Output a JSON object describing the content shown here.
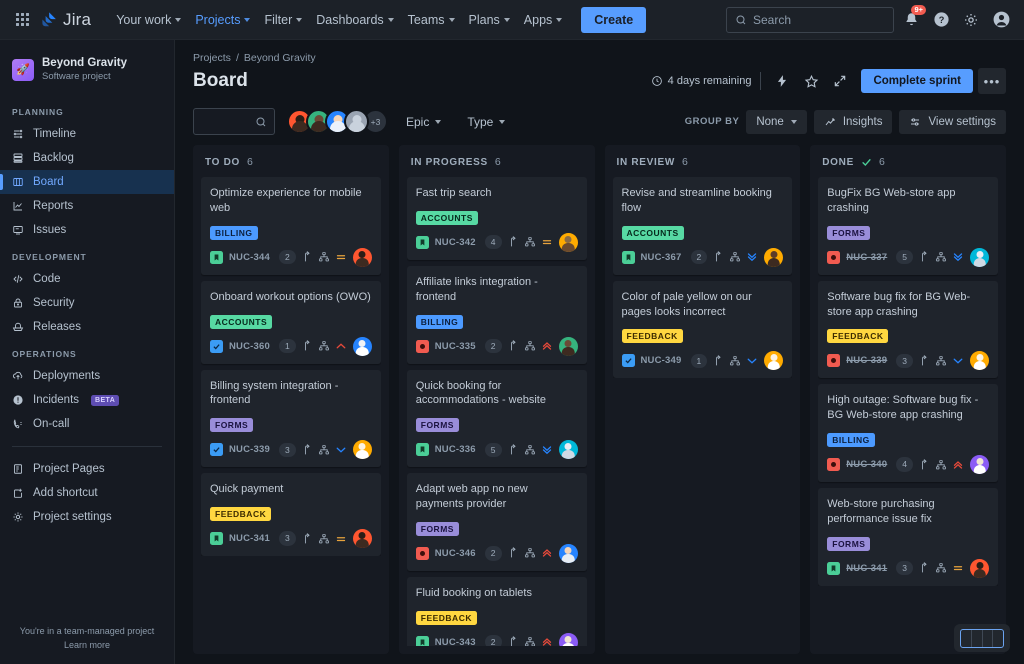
{
  "topnav": {
    "apps_label": "app-switcher",
    "brand": "Jira",
    "links": [
      {
        "label": "Your work",
        "caret": true,
        "active": false
      },
      {
        "label": "Projects",
        "caret": true,
        "active": true
      },
      {
        "label": "Filter",
        "caret": true,
        "active": false
      },
      {
        "label": "Dashboards",
        "caret": true,
        "active": false
      },
      {
        "label": "Teams",
        "caret": true,
        "active": false
      },
      {
        "label": "Plans",
        "caret": true,
        "active": false
      },
      {
        "label": "Apps",
        "caret": true,
        "active": false
      }
    ],
    "create_label": "Create",
    "search_placeholder": "Search",
    "notification_badge": "9+"
  },
  "sidebar": {
    "project_name": "Beyond Gravity",
    "project_type": "Software project",
    "sections": [
      {
        "title": "PLANNING",
        "items": [
          {
            "label": "Timeline",
            "icon": "timeline-icon",
            "selected": false
          },
          {
            "label": "Backlog",
            "icon": "backlog-icon",
            "selected": false
          },
          {
            "label": "Board",
            "icon": "board-icon",
            "selected": true
          },
          {
            "label": "Reports",
            "icon": "reports-icon",
            "selected": false
          },
          {
            "label": "Issues",
            "icon": "issues-icon",
            "selected": false
          }
        ]
      },
      {
        "title": "DEVELOPMENT",
        "items": [
          {
            "label": "Code",
            "icon": "code-icon",
            "selected": false
          },
          {
            "label": "Security",
            "icon": "lock-icon",
            "selected": false
          },
          {
            "label": "Releases",
            "icon": "releases-icon",
            "selected": false
          }
        ]
      },
      {
        "title": "OPERATIONS",
        "items": [
          {
            "label": "Deployments",
            "icon": "deployments-icon",
            "selected": false
          },
          {
            "label": "Incidents",
            "icon": "incidents-icon",
            "selected": false,
            "tag": "BETA"
          },
          {
            "label": "On-call",
            "icon": "oncall-icon",
            "selected": false
          }
        ]
      }
    ],
    "extra_items": [
      {
        "label": "Project Pages",
        "icon": "pages-icon"
      },
      {
        "label": "Add shortcut",
        "icon": "add-shortcut-icon"
      },
      {
        "label": "Project settings",
        "icon": "gear-icon"
      }
    ],
    "footer_line1": "You're in a team-managed project",
    "footer_line2": "Learn more"
  },
  "header": {
    "breadcrumb_projects": "Projects",
    "breadcrumb_sep": "/",
    "breadcrumb_project": "Beyond Gravity",
    "title": "Board",
    "days_remaining": "4 days remaining",
    "complete_sprint_label": "Complete sprint",
    "more_label": "•••"
  },
  "filterbar": {
    "search_placeholder": "",
    "avatars": [
      {
        "name": "avatar-1",
        "ring": "#ff5630",
        "head": "#3d2a20",
        "body": "#4a3328"
      },
      {
        "name": "avatar-2",
        "ring": "#36b37e",
        "head": "#6b4a36",
        "body": "#3d2a20"
      },
      {
        "name": "avatar-3",
        "ring": "#2684ff",
        "head": "#f5d5b8",
        "body": "#cfe3ff"
      },
      {
        "name": "avatar-4",
        "ring": "#9aa4b2",
        "head": "#c3ccd7",
        "body": "#c3ccd7"
      }
    ],
    "avatar_overflow": "+3",
    "epic_label": "Epic",
    "type_label": "Type",
    "group_by_label": "GROUP BY",
    "group_by_value": "None",
    "insights_label": "Insights",
    "view_settings_label": "View settings"
  },
  "columns": [
    {
      "name": "TO DO",
      "count": "6",
      "done": false,
      "cards": [
        {
          "title": "Optimize experience for mobile web",
          "epic": "BILLING",
          "epic_bg": "#4c9aff",
          "epic_fg": "#0c1f3d",
          "type": "story",
          "key": "NUC-344",
          "key_done": false,
          "pill": "2",
          "priority": "medium",
          "avatar": {
            "ring": "#ff5630",
            "head": "#2b1d16",
            "body": "#3d2a20"
          }
        },
        {
          "title": "Onboard workout options (OWO)",
          "epic": "ACCOUNTS",
          "epic_bg": "#57d9a3",
          "epic_fg": "#06291c",
          "type": "task",
          "key": "NUC-360",
          "key_done": false,
          "pill": "1",
          "priority": "high",
          "avatar": {
            "ring": "#2684ff",
            "head": "#f0f2f5",
            "body": "#ffffff"
          }
        },
        {
          "title": "Billing system integration - frontend",
          "epic": "FORMS",
          "epic_bg": "#998dd9",
          "epic_fg": "#1b1340",
          "type": "task",
          "key": "NUC-339",
          "key_done": false,
          "pill": "3",
          "priority": "low",
          "avatar": {
            "ring": "#ffab00",
            "head": "#fbf3e4",
            "body": "#ffffff"
          }
        },
        {
          "title": "Quick payment",
          "epic": "FEEDBACK",
          "epic_bg": "#ffd740",
          "epic_fg": "#3d2c00",
          "type": "story",
          "key": "NUC-341",
          "key_done": false,
          "pill": "3",
          "priority": "medium",
          "avatar": {
            "ring": "#ff5630",
            "head": "#2b1d16",
            "body": "#3d2a20"
          }
        }
      ]
    },
    {
      "name": "IN PROGRESS",
      "count": "6",
      "done": false,
      "cards": [
        {
          "title": "Fast trip search",
          "epic": "ACCOUNTS",
          "epic_bg": "#57d9a3",
          "epic_fg": "#06291c",
          "type": "story",
          "key": "NUC-342",
          "key_done": false,
          "pill": "4",
          "priority": "medium",
          "avatar": {
            "ring": "#ffab00",
            "head": "#8a6b45",
            "body": "#6b4a2e"
          }
        },
        {
          "title": "Affiliate links integration - frontend",
          "epic": "BILLING",
          "epic_bg": "#4c9aff",
          "epic_fg": "#0c1f3d",
          "type": "bug",
          "key": "NUC-335",
          "key_done": false,
          "pill": "2",
          "priority": "highest",
          "avatar": {
            "ring": "#36b37e",
            "head": "#6b4a36",
            "body": "#3d2a20"
          }
        },
        {
          "title": "Quick booking for accommodations - website",
          "epic": "FORMS",
          "epic_bg": "#998dd9",
          "epic_fg": "#1b1340",
          "type": "story",
          "key": "NUC-336",
          "key_done": false,
          "pill": "5",
          "priority": "lowest",
          "avatar": {
            "ring": "#00b8d9",
            "head": "#e8eef5",
            "body": "#cfd9e4"
          }
        },
        {
          "title": "Adapt web app no new payments provider",
          "epic": "FORMS",
          "epic_bg": "#998dd9",
          "epic_fg": "#1b1340",
          "type": "bug",
          "key": "NUC-346",
          "key_done": false,
          "pill": "2",
          "priority": "highest",
          "avatar": {
            "ring": "#2684ff",
            "head": "#f5d5b8",
            "body": "#e8eef5"
          }
        },
        {
          "title": "Fluid booking on tablets",
          "epic": "FEEDBACK",
          "epic_bg": "#ffd740",
          "epic_fg": "#3d2c00",
          "type": "story",
          "key": "NUC-343",
          "key_done": false,
          "pill": "2",
          "priority": "highest",
          "avatar": {
            "ring": "#8b5cf6",
            "head": "#f0e6d2",
            "body": "#ffffff"
          }
        }
      ]
    },
    {
      "name": "IN REVIEW",
      "count": "6",
      "done": false,
      "cards": [
        {
          "title": "Revise and streamline booking flow",
          "epic": "ACCOUNTS",
          "epic_bg": "#57d9a3",
          "epic_fg": "#06291c",
          "type": "story",
          "key": "NUC-367",
          "key_done": false,
          "pill": "2",
          "priority": "lowest",
          "avatar": {
            "ring": "#ffab00",
            "head": "#5c3c28",
            "body": "#3d2a20"
          }
        },
        {
          "title": "Color of pale yellow on our pages looks incorrect",
          "epic": "FEEDBACK",
          "epic_bg": "#ffd740",
          "epic_fg": "#3d2c00",
          "type": "task",
          "key": "NUC-349",
          "key_done": false,
          "pill": "1",
          "priority": "low",
          "avatar": {
            "ring": "#ffab00",
            "head": "#fbf3e4",
            "body": "#ffffff"
          }
        }
      ]
    },
    {
      "name": "DONE",
      "count": "6",
      "done": true,
      "cards": [
        {
          "title": "BugFix BG Web-store app crashing",
          "epic": "FORMS",
          "epic_bg": "#998dd9",
          "epic_fg": "#1b1340",
          "type": "bug",
          "key": "NUC-337",
          "key_done": true,
          "pill": "5",
          "priority": "lowest",
          "avatar": {
            "ring": "#00b8d9",
            "head": "#e8eef5",
            "body": "#cfd9e4"
          }
        },
        {
          "title": "Software bug fix for BG Web-store app crashing",
          "epic": "FEEDBACK",
          "epic_bg": "#ffd740",
          "epic_fg": "#3d2c00",
          "type": "bug",
          "key": "NUC-339",
          "key_done": true,
          "pill": "3",
          "priority": "low",
          "avatar": {
            "ring": "#ffab00",
            "head": "#fbf3e4",
            "body": "#ffffff"
          }
        },
        {
          "title": "High outage: Software bug fix - BG Web-store app crashing",
          "epic": "BILLING",
          "epic_bg": "#4c9aff",
          "epic_fg": "#0c1f3d",
          "type": "bug",
          "key": "NUC-340",
          "key_done": true,
          "pill": "4",
          "priority": "highest",
          "avatar": {
            "ring": "#8b5cf6",
            "head": "#f0e6d2",
            "body": "#ffffff"
          }
        },
        {
          "title": "Web-store purchasing performance issue fix",
          "epic": "FORMS",
          "epic_bg": "#998dd9",
          "epic_fg": "#1b1340",
          "type": "story",
          "key": "NUC-341",
          "key_done": true,
          "pill": "3",
          "priority": "medium",
          "avatar": {
            "ring": "#ff5630",
            "head": "#2b1d16",
            "body": "#3d2a20"
          }
        }
      ]
    }
  ],
  "colors": {
    "accent": "#579dff",
    "done_check": "#4bce97",
    "priority_high": "#e5493a",
    "priority_low": "#2684ff",
    "page_bg": "#10141a"
  }
}
